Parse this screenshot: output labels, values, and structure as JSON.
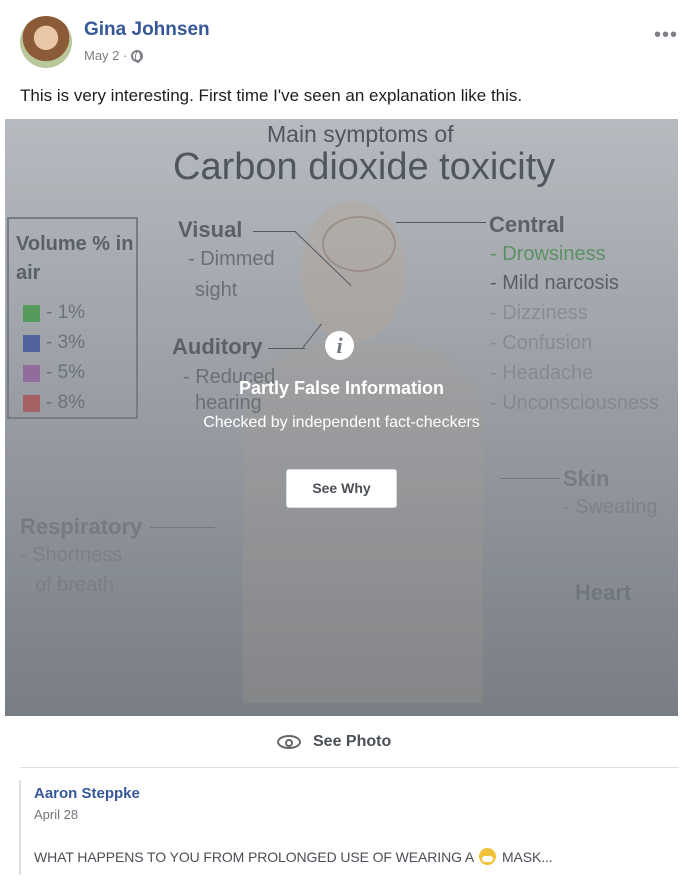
{
  "post": {
    "author": "Gina Johnsen",
    "date": "May 2 ·",
    "text": "This is very interesting. First time I've seen an explanation like this."
  },
  "image": {
    "small_title": "Main symptoms of",
    "title": "Carbon dioxide toxicity",
    "legend_title": "Volume % in air",
    "legend": [
      {
        "label": "- 1%",
        "color": "#53a65b"
      },
      {
        "label": "- 3%",
        "color": "#5365a8"
      },
      {
        "label": "- 5%",
        "color": "#9c70aa"
      },
      {
        "label": "- 8%",
        "color": "#b56266"
      }
    ],
    "sections": {
      "visual": "Visual",
      "auditory": "Auditory",
      "central": "Central",
      "skin": "Skin",
      "respiratory": "Respiratory",
      "heart": "Heart"
    },
    "items": {
      "visual_1": "- Dimmed",
      "visual_2": "sight",
      "auditory_1": "- Reduced",
      "auditory_2": "hearing",
      "central_1": "- Drowsiness",
      "central_2": "- Mild narcosis",
      "central_3": "- Dizziness",
      "central_4": "- Confusion",
      "central_5": "- Headache",
      "central_6": "- Unconsciousness",
      "skin_1": "- Sweating",
      "respiratory_1": "- Shortness",
      "respiratory_2": "of breath"
    },
    "overlay": {
      "info_icon": "i",
      "title": "Partly False Information",
      "subtitle": "Checked by independent fact-checkers",
      "button": "See Why"
    }
  },
  "actions": {
    "see_photo": "See Photo"
  },
  "shared_post": {
    "author": "Aaron Steppke",
    "date": "April 28",
    "text_before": "WHAT HAPPENS TO YOU FROM PROLONGED USE OF WEARING A",
    "text_after": "MASK..."
  },
  "icons": [
    "globe-icon",
    "more-options-icon",
    "info-icon",
    "eye-icon",
    "mask-emoji-icon"
  ]
}
